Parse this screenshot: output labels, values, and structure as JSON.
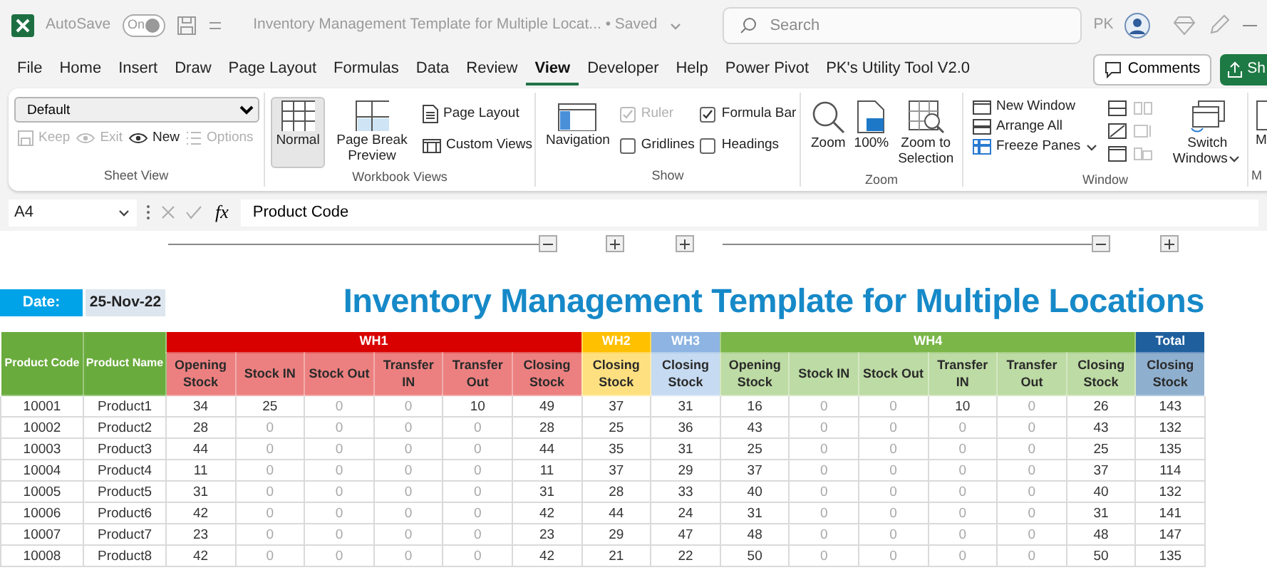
{
  "title_bar": {
    "autosave_label": "AutoSave",
    "autosave": {
      "text": "On",
      "on": true
    },
    "document_title": "Inventory Management Template for Multiple Locat... • Saved",
    "search": {
      "placeholder": "Search"
    },
    "user_initials": "PK"
  },
  "menu_tabs": [
    {
      "label": "File",
      "selected": false
    },
    {
      "label": "Home",
      "selected": false
    },
    {
      "label": "Insert",
      "selected": false
    },
    {
      "label": "Draw",
      "selected": false
    },
    {
      "label": "Page Layout",
      "selected": false
    },
    {
      "label": "Formulas",
      "selected": false
    },
    {
      "label": "Data",
      "selected": false
    },
    {
      "label": "Review",
      "selected": false
    },
    {
      "label": "View",
      "selected": true
    },
    {
      "label": "Developer",
      "selected": false
    },
    {
      "label": "Help",
      "selected": false
    },
    {
      "label": "Power Pivot",
      "selected": false
    },
    {
      "label": "PK's Utility Tool V2.0",
      "selected": false
    }
  ],
  "comments_button": "Comments",
  "share_button": "Sh",
  "ribbon": {
    "sheet_view": {
      "label": "Sheet View",
      "dropdown": "Default",
      "buttons": [
        {
          "label": "Keep",
          "disabled": true
        },
        {
          "label": "Exit",
          "disabled": true
        },
        {
          "label": "New",
          "disabled": false
        },
        {
          "label": "Options",
          "disabled": true
        }
      ]
    },
    "workbook_views": {
      "label": "Workbook Views",
      "large_buttons": [
        {
          "label": "Normal",
          "selected": true
        },
        {
          "label": "Page Break Preview",
          "selected": false
        }
      ],
      "small_buttons": [
        "Page Layout",
        "Custom Views"
      ]
    },
    "show": {
      "label": "Show",
      "navigation": "Navigation",
      "checkboxes": [
        {
          "label": "Ruler",
          "checked": true,
          "disabled": true
        },
        {
          "label": "Gridlines",
          "checked": false,
          "disabled": false
        },
        {
          "label": "Formula Bar",
          "checked": true,
          "disabled": false
        },
        {
          "label": "Headings",
          "checked": false,
          "disabled": false
        }
      ]
    },
    "zoom": {
      "label": "Zoom",
      "buttons": [
        "Zoom",
        "100%",
        "Zoom to Selection"
      ]
    },
    "window": {
      "label": "Window",
      "small_buttons": [
        "New Window",
        "Arrange All",
        "Freeze Panes"
      ],
      "icon_buttons": [
        {
          "disabled": false
        },
        {
          "disabled": false
        },
        {
          "disabled": false
        },
        {
          "disabled": true
        },
        {
          "disabled": true
        },
        {
          "disabled": true
        }
      ],
      "large_button": "Switch Windows"
    },
    "next_group": {
      "button": "M",
      "label": "M"
    }
  },
  "formula_bar": {
    "name_box": "A4",
    "fx": "fx",
    "content": "Product Code"
  },
  "sheet": {
    "date_label": "Date:",
    "date_value": "25-Nov-22",
    "title": "Inventory Management Template for Multiple Locations",
    "fixed_columns": [
      "Product Code",
      "Product Name"
    ],
    "groups": [
      {
        "label": "WH1",
        "color": "#d90000",
        "expanded": true,
        "columns": [
          "Opening Stock",
          "Stock IN",
          "Stock Out",
          "Transfer IN",
          "Transfer Out",
          "Closing Stock"
        ]
      },
      {
        "label": "WH2",
        "color": "#ffc000",
        "expanded": false,
        "columns": [
          "Closing Stock"
        ]
      },
      {
        "label": "WH3",
        "color": "#8db4e2",
        "expanded": false,
        "columns": [
          "Closing Stock"
        ]
      },
      {
        "label": "WH4",
        "color": "#7ab648",
        "expanded": true,
        "columns": [
          "Opening Stock",
          "Stock IN",
          "Stock Out",
          "Transfer IN",
          "Transfer Out",
          "Closing Stock"
        ]
      },
      {
        "label": "Total",
        "color": "#1f5f9e",
        "expanded": false,
        "columns": [
          "Closing Stock"
        ]
      }
    ],
    "rows": [
      {
        "code": "10001",
        "name": "Product1",
        "cells": [
          {
            "text": "34",
            "muted": false
          },
          {
            "text": "25",
            "muted": false
          },
          {
            "text": "0",
            "muted": true
          },
          {
            "text": "0",
            "muted": true
          },
          {
            "text": "10",
            "muted": false
          },
          {
            "text": "49",
            "muted": false
          },
          {
            "text": "37",
            "muted": false
          },
          {
            "text": "31",
            "muted": false
          },
          {
            "text": "16",
            "muted": false
          },
          {
            "text": "0",
            "muted": true
          },
          {
            "text": "0",
            "muted": true
          },
          {
            "text": "10",
            "muted": false
          },
          {
            "text": "0",
            "muted": true
          },
          {
            "text": "26",
            "muted": false
          },
          {
            "text": "143",
            "muted": false
          }
        ]
      },
      {
        "code": "10002",
        "name": "Product2",
        "cells": [
          {
            "text": "28",
            "muted": false
          },
          {
            "text": "0",
            "muted": true
          },
          {
            "text": "0",
            "muted": true
          },
          {
            "text": "0",
            "muted": true
          },
          {
            "text": "0",
            "muted": true
          },
          {
            "text": "28",
            "muted": false
          },
          {
            "text": "25",
            "muted": false
          },
          {
            "text": "36",
            "muted": false
          },
          {
            "text": "43",
            "muted": false
          },
          {
            "text": "0",
            "muted": true
          },
          {
            "text": "0",
            "muted": true
          },
          {
            "text": "0",
            "muted": true
          },
          {
            "text": "0",
            "muted": true
          },
          {
            "text": "43",
            "muted": false
          },
          {
            "text": "132",
            "muted": false
          }
        ]
      },
      {
        "code": "10003",
        "name": "Product3",
        "cells": [
          {
            "text": "44",
            "muted": false
          },
          {
            "text": "0",
            "muted": true
          },
          {
            "text": "0",
            "muted": true
          },
          {
            "text": "0",
            "muted": true
          },
          {
            "text": "0",
            "muted": true
          },
          {
            "text": "44",
            "muted": false
          },
          {
            "text": "35",
            "muted": false
          },
          {
            "text": "31",
            "muted": false
          },
          {
            "text": "25",
            "muted": false
          },
          {
            "text": "0",
            "muted": true
          },
          {
            "text": "0",
            "muted": true
          },
          {
            "text": "0",
            "muted": true
          },
          {
            "text": "0",
            "muted": true
          },
          {
            "text": "25",
            "muted": false
          },
          {
            "text": "135",
            "muted": false
          }
        ]
      },
      {
        "code": "10004",
        "name": "Product4",
        "cells": [
          {
            "text": "11",
            "muted": false
          },
          {
            "text": "0",
            "muted": true
          },
          {
            "text": "0",
            "muted": true
          },
          {
            "text": "0",
            "muted": true
          },
          {
            "text": "0",
            "muted": true
          },
          {
            "text": "11",
            "muted": false
          },
          {
            "text": "37",
            "muted": false
          },
          {
            "text": "29",
            "muted": false
          },
          {
            "text": "37",
            "muted": false
          },
          {
            "text": "0",
            "muted": true
          },
          {
            "text": "0",
            "muted": true
          },
          {
            "text": "0",
            "muted": true
          },
          {
            "text": "0",
            "muted": true
          },
          {
            "text": "37",
            "muted": false
          },
          {
            "text": "114",
            "muted": false
          }
        ]
      },
      {
        "code": "10005",
        "name": "Product5",
        "cells": [
          {
            "text": "31",
            "muted": false
          },
          {
            "text": "0",
            "muted": true
          },
          {
            "text": "0",
            "muted": true
          },
          {
            "text": "0",
            "muted": true
          },
          {
            "text": "0",
            "muted": true
          },
          {
            "text": "31",
            "muted": false
          },
          {
            "text": "28",
            "muted": false
          },
          {
            "text": "33",
            "muted": false
          },
          {
            "text": "40",
            "muted": false
          },
          {
            "text": "0",
            "muted": true
          },
          {
            "text": "0",
            "muted": true
          },
          {
            "text": "0",
            "muted": true
          },
          {
            "text": "0",
            "muted": true
          },
          {
            "text": "40",
            "muted": false
          },
          {
            "text": "132",
            "muted": false
          }
        ]
      },
      {
        "code": "10006",
        "name": "Product6",
        "cells": [
          {
            "text": "42",
            "muted": false
          },
          {
            "text": "0",
            "muted": true
          },
          {
            "text": "0",
            "muted": true
          },
          {
            "text": "0",
            "muted": true
          },
          {
            "text": "0",
            "muted": true
          },
          {
            "text": "42",
            "muted": false
          },
          {
            "text": "44",
            "muted": false
          },
          {
            "text": "24",
            "muted": false
          },
          {
            "text": "31",
            "muted": false
          },
          {
            "text": "0",
            "muted": true
          },
          {
            "text": "0",
            "muted": true
          },
          {
            "text": "0",
            "muted": true
          },
          {
            "text": "0",
            "muted": true
          },
          {
            "text": "31",
            "muted": false
          },
          {
            "text": "141",
            "muted": false
          }
        ]
      },
      {
        "code": "10007",
        "name": "Product7",
        "cells": [
          {
            "text": "23",
            "muted": false
          },
          {
            "text": "0",
            "muted": true
          },
          {
            "text": "0",
            "muted": true
          },
          {
            "text": "0",
            "muted": true
          },
          {
            "text": "0",
            "muted": true
          },
          {
            "text": "23",
            "muted": false
          },
          {
            "text": "29",
            "muted": false
          },
          {
            "text": "47",
            "muted": false
          },
          {
            "text": "48",
            "muted": false
          },
          {
            "text": "0",
            "muted": true
          },
          {
            "text": "0",
            "muted": true
          },
          {
            "text": "0",
            "muted": true
          },
          {
            "text": "0",
            "muted": true
          },
          {
            "text": "48",
            "muted": false
          },
          {
            "text": "147",
            "muted": false
          }
        ]
      },
      {
        "code": "10008",
        "name": "Product8",
        "cells": [
          {
            "text": "42",
            "muted": false
          },
          {
            "text": "0",
            "muted": true
          },
          {
            "text": "0",
            "muted": true
          },
          {
            "text": "0",
            "muted": true
          },
          {
            "text": "0",
            "muted": true
          },
          {
            "text": "42",
            "muted": false
          },
          {
            "text": "21",
            "muted": false
          },
          {
            "text": "22",
            "muted": false
          },
          {
            "text": "50",
            "muted": false
          },
          {
            "text": "0",
            "muted": true
          },
          {
            "text": "0",
            "muted": true
          },
          {
            "text": "0",
            "muted": true
          },
          {
            "text": "0",
            "muted": true
          },
          {
            "text": "50",
            "muted": false
          },
          {
            "text": "135",
            "muted": false
          }
        ]
      }
    ]
  }
}
